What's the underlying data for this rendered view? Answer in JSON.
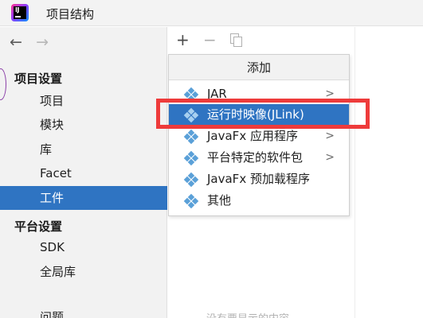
{
  "window": {
    "title": "项目结构",
    "app_icon": "intellij-idea-icon"
  },
  "nav": {
    "back": "←",
    "forward": "→"
  },
  "sidebar": {
    "project_settings_header": "项目设置",
    "project_items": [
      {
        "label": "项目"
      },
      {
        "label": "模块"
      },
      {
        "label": "库"
      },
      {
        "label": "Facet"
      },
      {
        "label": "工件",
        "selected": true
      }
    ],
    "platform_settings_header": "平台设置",
    "platform_items": [
      {
        "label": "SDK"
      },
      {
        "label": "全局库"
      }
    ],
    "problems_item": "问题"
  },
  "toolbar": {
    "add": "+",
    "remove": "−"
  },
  "popup": {
    "header": "添加",
    "items": [
      {
        "label": "JAR",
        "submenu": true
      },
      {
        "label": "运行时映像(JLink)",
        "submenu": false,
        "active": true
      },
      {
        "label": "JavaFx 应用程序",
        "submenu": true
      },
      {
        "label": "平台特定的软件包",
        "submenu": true
      },
      {
        "label": "JavaFx 预加载程序",
        "submenu": false
      },
      {
        "label": "其他",
        "submenu": false
      }
    ],
    "chevron": ">"
  },
  "empty_hint": "没有要显示的内容",
  "colors": {
    "selection": "#2f74c2",
    "highlight_box": "#ee3b3b",
    "artifact_icon": "#5aa0d8"
  }
}
